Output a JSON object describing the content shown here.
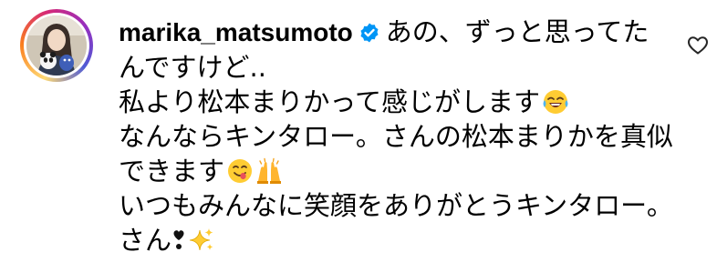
{
  "comment": {
    "username": "marika_matsumoto",
    "verified": true,
    "lines": [
      "あの、ずっと思ってた",
      "んですけど..",
      "私より松本まりかって感じがします",
      "なんならキンタロー。さんの松本まりかを真似",
      "できます",
      "いつもみんなに笑顔をありがとうキンタロー。",
      "さん"
    ],
    "emojis": {
      "line3": "face-with-tears-of-joy-icon",
      "line5a": "face-savoring-food-icon",
      "line5b": "raising-hands-icon",
      "line7a": "heart-exclamation-icon",
      "line7b": "sparkles-icon"
    }
  },
  "colors": {
    "verified_badge": "#0095f6",
    "text": "#000000",
    "like_icon": "#262626"
  },
  "icons": {
    "like": "heart-outline-icon",
    "avatar_ring": "story-ring"
  }
}
